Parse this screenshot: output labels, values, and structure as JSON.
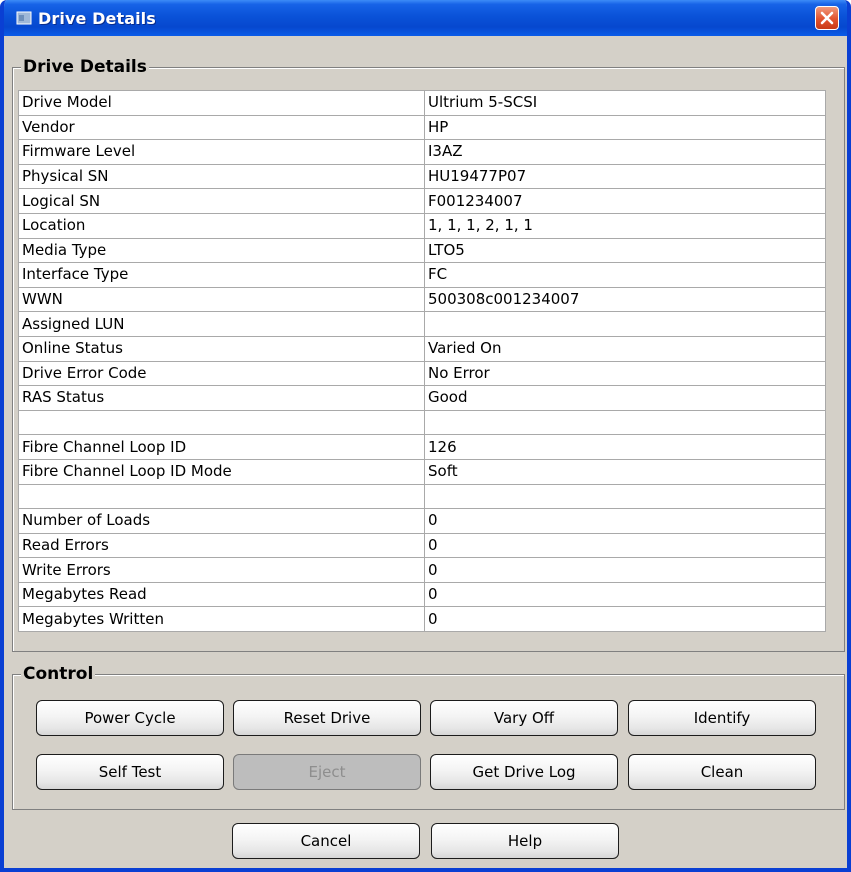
{
  "window": {
    "title": "Drive Details"
  },
  "details": {
    "legend": "Drive Details",
    "rows": [
      {
        "key": "Drive Model",
        "value": "Ultrium 5-SCSI"
      },
      {
        "key": "Vendor",
        "value": "HP"
      },
      {
        "key": "Firmware Level",
        "value": "I3AZ"
      },
      {
        "key": "Physical SN",
        "value": "HU19477P07"
      },
      {
        "key": "Logical SN",
        "value": "F001234007"
      },
      {
        "key": "Location",
        "value": "1, 1, 1, 2, 1, 1"
      },
      {
        "key": "Media Type",
        "value": "LTO5"
      },
      {
        "key": "Interface Type",
        "value": "FC"
      },
      {
        "key": "WWN",
        "value": "500308c001234007"
      },
      {
        "key": "Assigned LUN",
        "value": ""
      },
      {
        "key": "Online Status",
        "value": "Varied On"
      },
      {
        "key": "Drive Error Code",
        "value": "No Error"
      },
      {
        "key": "RAS Status",
        "value": "Good"
      },
      {
        "key": "",
        "value": ""
      },
      {
        "key": "Fibre Channel Loop ID",
        "value": "126"
      },
      {
        "key": "Fibre Channel Loop ID Mode",
        "value": "Soft"
      },
      {
        "key": "",
        "value": ""
      },
      {
        "key": "Number of Loads",
        "value": "0"
      },
      {
        "key": "Read Errors",
        "value": "0"
      },
      {
        "key": "Write Errors",
        "value": "0"
      },
      {
        "key": "Megabytes Read",
        "value": "0"
      },
      {
        "key": "Megabytes Written",
        "value": "0"
      }
    ]
  },
  "control": {
    "legend": "Control",
    "buttons": [
      {
        "label": "Power Cycle",
        "enabled": true
      },
      {
        "label": "Reset Drive",
        "enabled": true
      },
      {
        "label": "Vary Off",
        "enabled": true
      },
      {
        "label": "Identify",
        "enabled": true
      },
      {
        "label": "Self Test",
        "enabled": true
      },
      {
        "label": "Eject",
        "enabled": false
      },
      {
        "label": "Get Drive Log",
        "enabled": true
      },
      {
        "label": "Clean",
        "enabled": true
      }
    ]
  },
  "footer": {
    "cancel_label": "Cancel",
    "help_label": "Help"
  },
  "icons": {
    "title": "app-window-icon",
    "close": "close-icon"
  },
  "colors": {
    "titlebar": "#0a52d8",
    "close": "#e2532e",
    "panel": "#d4d0c8"
  }
}
